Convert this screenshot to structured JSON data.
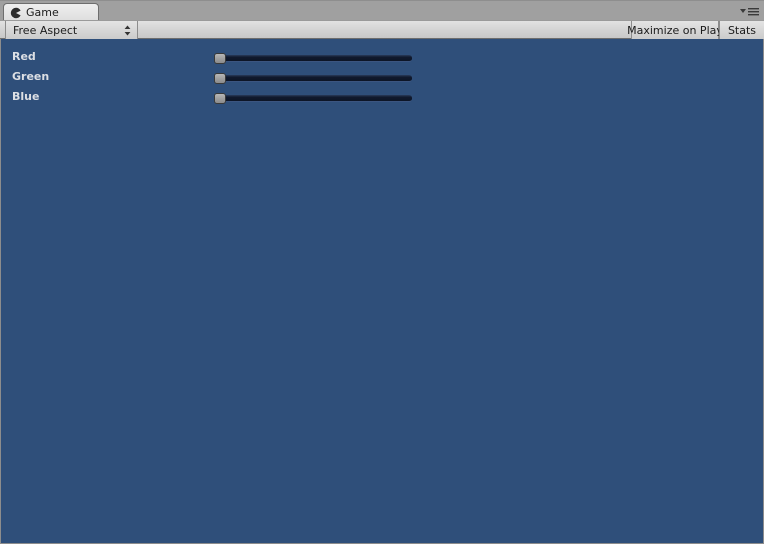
{
  "window": {
    "tab": {
      "label": "Game",
      "icon": "game-view-icon"
    },
    "panel_menu_icon": "panel-options-hamburger-icon"
  },
  "toolbar": {
    "aspect_ratio": {
      "label": "Free Aspect",
      "icon": "updown-arrows-icon"
    },
    "maximize_on_play_label": "Maximize on Play",
    "stats_label": "Stats"
  },
  "game": {
    "background_color": "#2f4f7a",
    "controls": [
      {
        "name": "red",
        "label": "Red",
        "value": 0,
        "min": 0,
        "max": 1,
        "handle_percent": 0
      },
      {
        "name": "green",
        "label": "Green",
        "value": 0,
        "min": 0,
        "max": 1,
        "handle_percent": 0
      },
      {
        "name": "blue",
        "label": "Blue",
        "value": 0,
        "min": 0,
        "max": 1,
        "handle_percent": 0
      }
    ]
  },
  "colors": {
    "game_background": "#2f4f7a",
    "chrome_gray": "#a0a0a0",
    "toolbar_gray": "#d4d4d4",
    "slider_track": "#111a2e",
    "slider_handle": "#a2a2a2",
    "label_text": "#dcdfe4"
  }
}
